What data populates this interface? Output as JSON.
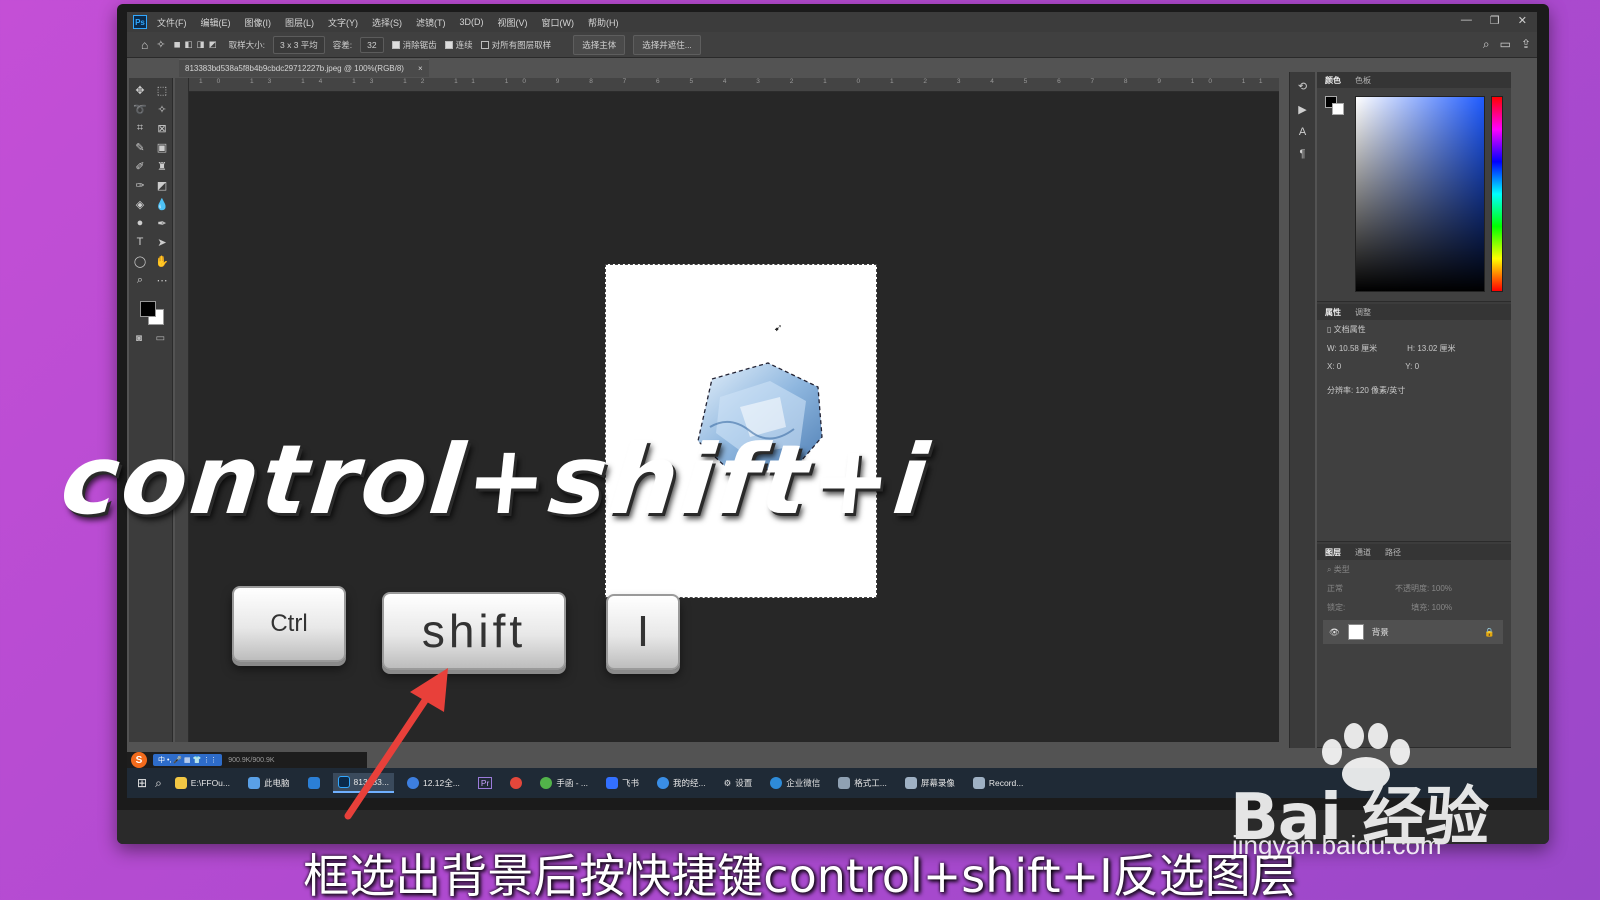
{
  "app": {
    "logo": "Ps",
    "menu": [
      "文件(F)",
      "编辑(E)",
      "图像(I)",
      "图层(L)",
      "文字(Y)",
      "选择(S)",
      "滤镜(T)",
      "3D(D)",
      "视图(V)",
      "窗口(W)",
      "帮助(H)"
    ],
    "window_controls": [
      "—",
      "❐",
      "✕"
    ]
  },
  "options": {
    "sample_size_label": "取样大小:",
    "sample_size_value": "3 x 3 平均",
    "tolerance_label": "容差:",
    "tolerance_value": "32",
    "anti_alias": "消除锯齿",
    "contiguous": "连续",
    "sample_all": "对所有图层取样",
    "select_subject": "选择主体",
    "select_and_mask": "选择并遮住..."
  },
  "document": {
    "tab_title": "813383bd538a5f8b4b9cbdc29712227b.jpeg @ 100%(RGB/8)",
    "tab_close": "×",
    "ruler_numbers": "10 13 14 13 12 11 10 9 8 7 6 5 4 3 2 1 0 1 2 3 4 5 6 7 8 9 10 11 12 13 14 15 16 17 18 19 20 21 22 23 24 25 26"
  },
  "panels": {
    "color_tabs": [
      "颜色",
      "色板"
    ],
    "properties_tabs": [
      "属性",
      "调整"
    ],
    "doc_properties": "文档属性",
    "width": "W: 10.58 厘米",
    "height": "H: 13.02 厘米",
    "x": "X: 0",
    "y": "Y: 0",
    "resolution": "分辨率: 120 像素/英寸",
    "layers_tabs": [
      "图层",
      "通道",
      "路径"
    ],
    "layer_filter": "类型",
    "blend_mode": "正常",
    "opacity": "不透明度: 100%",
    "lock": "锁定:",
    "fill": "填充: 100%",
    "layer_name": "背景"
  },
  "status": {
    "doc_size": "900.9K/900.9K",
    "ime": [
      "中",
      "•,",
      "🎤",
      "▦",
      "👕",
      "⋮⋮"
    ]
  },
  "taskbar": {
    "items": [
      "E:\\FFOu...",
      "此电脑",
      "813383...",
      "12.12全...",
      "Pr",
      "手函 - ...",
      "飞书",
      "我的经...",
      "设置",
      "企业微信",
      "格式工...",
      "屏幕录像",
      "Record..."
    ]
  },
  "overlay": {
    "shortcut_text": "control+shift+i",
    "keys": [
      "Ctrl",
      "shift",
      "I"
    ],
    "caption": "框选出背景后按快捷键control+shift+I反选图层",
    "watermark_main": "Bai 经验",
    "watermark_sub": "jingyan.baidu.com"
  }
}
